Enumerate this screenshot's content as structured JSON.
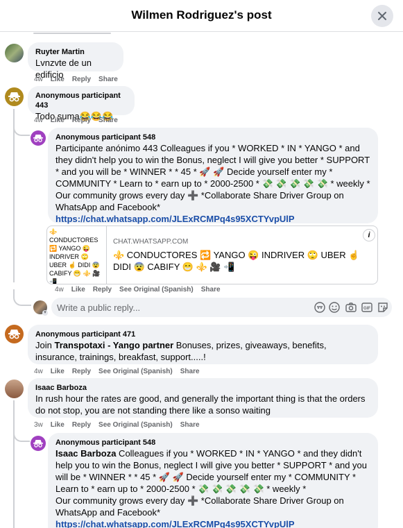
{
  "header": {
    "title": "Wilmen Rodriguez's post"
  },
  "comments": [
    {
      "author": "Ruyter Martin",
      "text": "Lvnzvte de un edificio",
      "time": "4w",
      "like": "Like",
      "reply": "Reply",
      "share": "Share"
    },
    {
      "author": "Anonymous participant 443",
      "text": "Todo suma😂😂😂",
      "time": "4w",
      "like": "Like",
      "reply": "Reply",
      "share": "Share"
    },
    {
      "author": "Anonymous participant 548",
      "text": "Participante anónimo 443 Colleagues if you * WORKED * IN * YANGO * and they didn't help you to win the Bonus, neglect I will give you better * SUPPORT * and you will be * WINNER * * 45 * 🚀 🚀 Decide yourself enter my * COMMUNITY * Learn to * earn up to * 2000-2500 * 💸 💸 💸 💸 💸 * weekly *\nOur community grows every day ➕ *Collaborate Share Driver Group on WhatsApp and Facebook*",
      "link": "https://chat.whatsapp.com/JLExRCMPq4s95XCTYvpUlP",
      "time": "4w",
      "like": "Like",
      "reply": "Reply",
      "see_original": "See Original (Spanish)",
      "share": "Share",
      "preview": {
        "thumb_text": "⚜️ CONDUCTORES 🔁 YANGO 😜 INDRIVER 🙄 UBER ☝️ DIDI 😨 CABIFY 😁 ⚜️ 🎥 📲",
        "domain": "CHAT.WHATSAPP.COM",
        "title": "⚜️ CONDUCTORES 🔁 YANGO 😜 INDRIVER 🙄 UBER ☝️ DIDI 😨 CABIFY 😁 ⚜️ 🎥 📲",
        "info": "i"
      }
    },
    {
      "author": "Anonymous participant 471",
      "mention": "Transpotaxi - Yango partner",
      "prefix": "Join",
      "text": " Bonuses, prizes, giveaways, benefits, insurance, trainings, breakfast, support.....!",
      "time": "4w",
      "like": "Like",
      "reply": "Reply",
      "see_original": "See Original (Spanish)",
      "share": "Share"
    },
    {
      "author": "Isaac Barboza",
      "text": "In rush hour the rates are good, and generally the important thing is that the orders do not stop, you are not standing there like a sonso waiting",
      "time": "3w",
      "like": "Like",
      "reply": "Reply",
      "see_original": "See Original (Spanish)",
      "share": "Share"
    },
    {
      "author": "Anonymous participant 548",
      "mention": "Isaac Barboza",
      "text": " Colleagues if you * WORKED * IN * YANGO * and they didn't help you to win the Bonus, neglect I will give you better * SUPPORT * and you will be * WINNER * * 45 * 🚀 🚀 Decide yourself enter my * COMMUNITY * Learn to * earn up to * 2000-2500 * 💸 💸 💸 💸 💸 * weekly *\nOur community grows every day ➕ *Collaborate Share Driver Group on WhatsApp and Facebook*",
      "link": "https://chat.whatsapp.com/JLExRCMPq4s95XCTYvpUlP"
    }
  ],
  "reply_input": {
    "placeholder": "Write a public reply..."
  },
  "colors": {
    "link": "#1b4ea8",
    "bubble": "#f0f2f5",
    "muted": "#65676b",
    "anon_purple": "#a040c0",
    "anon_gold": "#b08a1e",
    "anon_orange": "#c56a1f"
  }
}
